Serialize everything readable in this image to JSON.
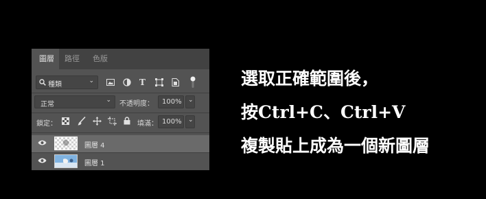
{
  "panel": {
    "tabs": [
      {
        "label": "圖層",
        "active": true
      },
      {
        "label": "路徑",
        "active": false
      },
      {
        "label": "色版",
        "active": false
      }
    ],
    "filter": {
      "search_icon": "magnifier-icon",
      "value": "種類"
    },
    "filter_icons": [
      "image-filter-icon",
      "adjustment-filter-icon",
      "type-filter-icon",
      "shape-filter-icon",
      "smart-object-filter-icon"
    ],
    "blend_mode": "正常",
    "opacity_label": "不透明度：",
    "opacity_value": "100%",
    "lock_label": "鎖定：",
    "fill_label": "填滿：",
    "fill_value": "100%",
    "layers": [
      {
        "name": "圖層 4",
        "selected": true,
        "visible": true
      },
      {
        "name": "圖層 1",
        "selected": false,
        "visible": true
      }
    ]
  },
  "caption": {
    "line1": "選取正確範圍後，",
    "line2": "按Ctrl+C、Ctrl+V",
    "line3": "複製貼上成為一個新圖層"
  },
  "colors": {
    "panel_bg": "#535353",
    "tab_bar": "#424242",
    "selected_layer": "#6a6a6a",
    "page_bg": "#000000"
  }
}
